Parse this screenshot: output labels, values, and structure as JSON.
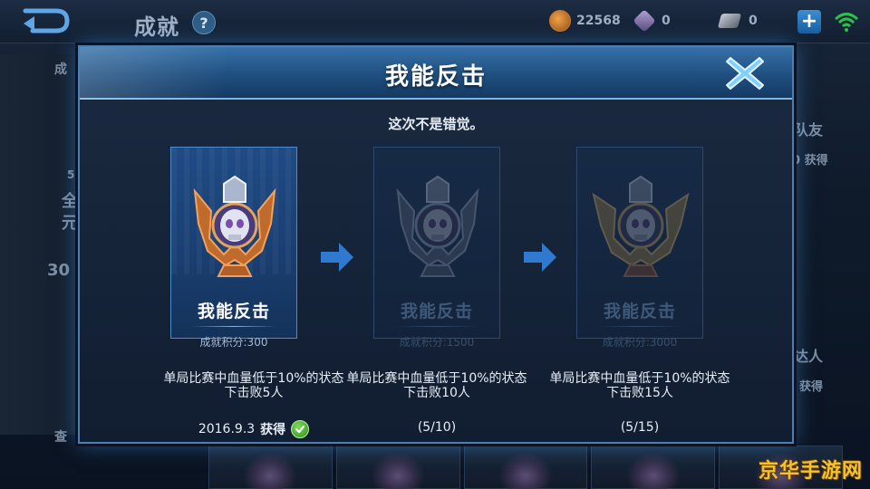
{
  "background": {
    "title": "成就",
    "help_label": "?",
    "currencies": {
      "gold": "22568",
      "gems": "0",
      "vouchers": "0"
    },
    "plus_label": "+",
    "left_fragments": [
      "成",
      "5",
      "全",
      "元",
      "30",
      "查"
    ],
    "right_fragments": [
      "队友",
      "0 获得",
      "达人",
      "获得"
    ],
    "watermark": "京华手游网"
  },
  "modal": {
    "title": "我能反击",
    "subtitle": "这次不是错觉。",
    "tiers": [
      {
        "name": "我能反击",
        "points": "成就积分:300",
        "description": "单局比赛中血量低于10%的状态下击败5人",
        "obtained_date": "2016.9.3",
        "obtained_label": "获得",
        "state": "achieved",
        "tier": "bronze"
      },
      {
        "name": "我能反击",
        "points": "成就积分:1500",
        "description": "单局比赛中血量低于10%的状态下击败10人",
        "progress": "(5/10)",
        "state": "locked",
        "tier": "silver"
      },
      {
        "name": "我能反击",
        "points": "成就积分:3000",
        "description": "单局比赛中血量低于10%的状态下击败15人",
        "progress": "(5/15)",
        "state": "locked",
        "tier": "gold"
      }
    ]
  },
  "colors": {
    "accent": "#4d7fb2",
    "header": "#2a5e94",
    "check_green": "#3fae2a",
    "arrow_blue": "#2f7ad0",
    "watermark": "#f2c230"
  },
  "icons": {
    "back": "back-arrow-icon",
    "help": "question-icon",
    "close": "close-x-icon",
    "check": "check-icon",
    "next": "right-arrow-icon"
  }
}
